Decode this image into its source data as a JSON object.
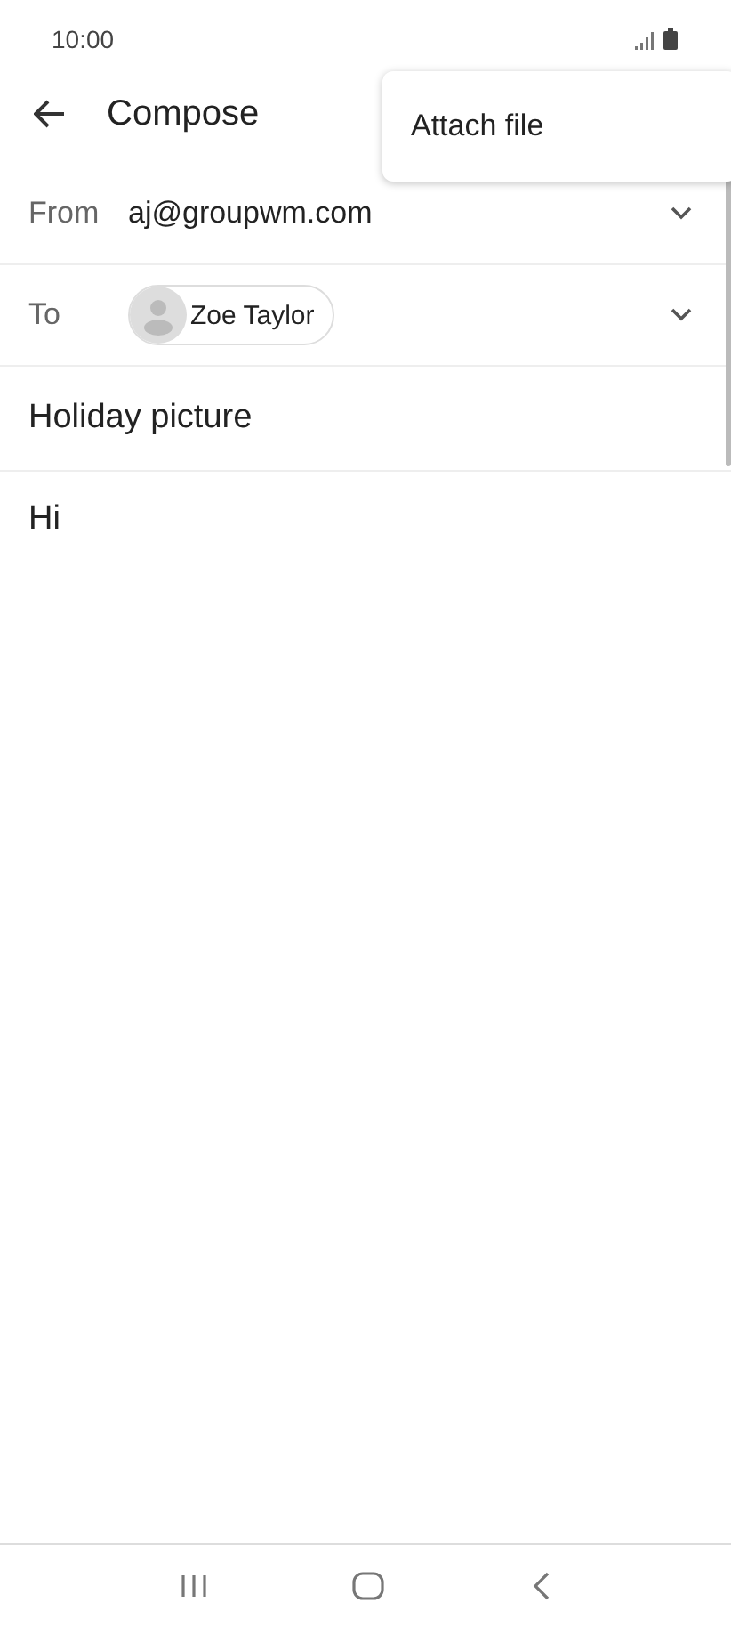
{
  "status_bar": {
    "time": "10:00"
  },
  "app_bar": {
    "title": "Compose"
  },
  "from": {
    "label": "From",
    "value": "aj@groupwm.com"
  },
  "to": {
    "label": "To",
    "recipients": [
      {
        "name": "Zoe Taylor"
      }
    ]
  },
  "subject": {
    "value": "Holiday picture"
  },
  "body": {
    "value": "Hi"
  },
  "menu": {
    "items": [
      {
        "label": "Attach file"
      }
    ]
  }
}
